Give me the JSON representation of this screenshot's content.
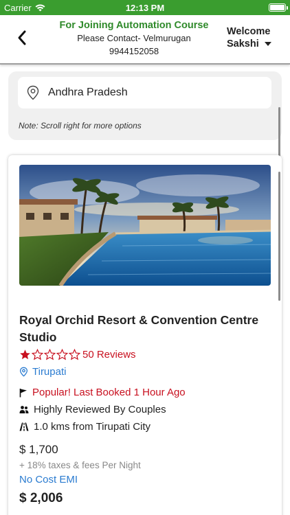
{
  "status_bar": {
    "carrier": "Carrier",
    "time": "12:13 PM"
  },
  "header": {
    "title": "For Joining Automation Course",
    "contact_line": "Please Contact- Velmurugan",
    "phone": "9944152058",
    "welcome_label": "Welcome",
    "user_name": "Sakshi",
    "accent_color": "#2f8a2a"
  },
  "search": {
    "value": "Andhra Pradesh",
    "note": "Note: Scroll right for more options"
  },
  "hotel": {
    "name": "Royal Orchid Resort & Convention Centre Studio",
    "rating": 1,
    "rating_max": 5,
    "reviews": "50 Reviews",
    "location": "Tirupati",
    "popular": "Popular! Last Booked 1 Hour Ago",
    "couples": "Highly Reviewed By Couples",
    "distance": "1.0 kms from Tirupati City",
    "price": "$ 1,700",
    "taxes": "+ 18% taxes & fees Per Night",
    "emi": "No Cost EMI",
    "total_price": "$ 2,006"
  },
  "colors": {
    "status_green": "#3a9d2f",
    "alert_red": "#c8101f",
    "link_blue": "#2a7bd0"
  }
}
